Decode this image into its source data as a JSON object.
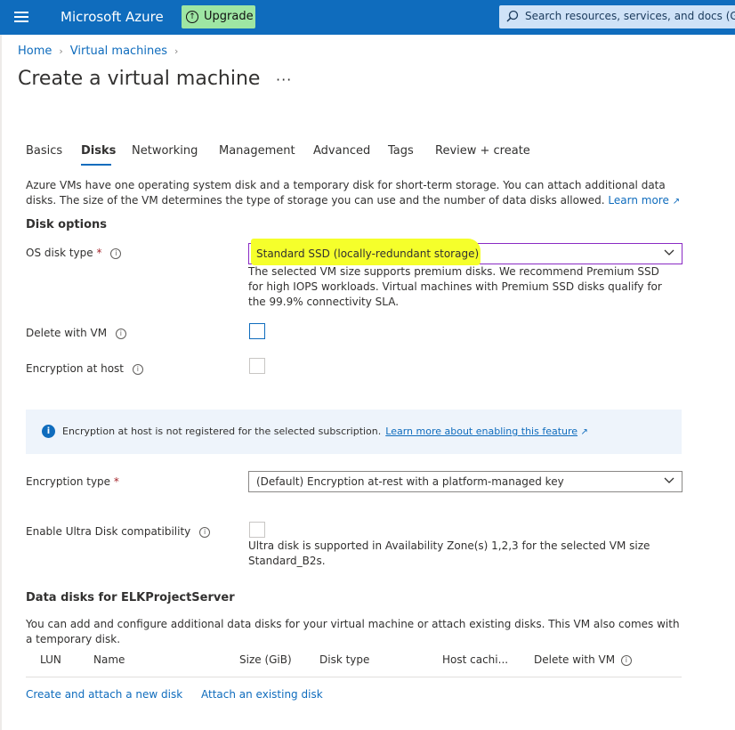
{
  "topbar": {
    "brand": "Microsoft Azure",
    "upgrade_label": "Upgrade",
    "search_placeholder": "Search resources, services, and docs (G+/)"
  },
  "breadcrumb": [
    "Home",
    "Virtual machines"
  ],
  "page_title": "Create a virtual machine",
  "tabs": [
    "Basics",
    "Disks",
    "Networking",
    "Management",
    "Advanced",
    "Tags",
    "Review + create"
  ],
  "active_tab": "Disks",
  "intro": {
    "text": "Azure VMs have one operating system disk and a temporary disk for short-term storage. You can attach additional data disks. The size of the VM determines the type of storage you can use and the number of data disks allowed.",
    "learn_more": "Learn more"
  },
  "disk_options": {
    "heading": "Disk options",
    "os_disk_type": {
      "label": "OS disk type",
      "required": "*",
      "value": "Standard SSD (locally-redundant storage)",
      "helper": "The selected VM size supports premium disks. We recommend Premium SSD for high IOPS workloads. Virtual machines with Premium SSD disks qualify for the 99.9% connectivity SLA.",
      "highlight_color": "#f5ff2b"
    },
    "delete_with_vm": {
      "label": "Delete with VM",
      "checked": false
    },
    "encryption_at_host": {
      "label": "Encryption at host",
      "checked": false,
      "disabled": true
    },
    "banner": {
      "text": "Encryption at host is not registered for the selected subscription.",
      "link": "Learn more about enabling this feature"
    },
    "encryption_type": {
      "label": "Encryption type",
      "required": "*",
      "value": "(Default) Encryption at-rest with a platform-managed key"
    },
    "ultra_disk": {
      "label": "Enable Ultra Disk compatibility",
      "checked": false,
      "helper_line1": "Ultra disk is supported in Availability Zone(s) 1,2,3 for the selected VM size",
      "helper_line2": "Standard_B2s."
    }
  },
  "data_disks": {
    "heading": "Data disks for ELKProjectServer",
    "description": "You can add and configure additional data disks for your virtual machine or attach existing disks. This VM also comes with a temporary disk.",
    "columns": [
      "LUN",
      "Name",
      "Size (GiB)",
      "Disk type",
      "Host cachi...",
      "Delete with VM"
    ],
    "create_link": "Create and attach a new disk",
    "attach_link": "Attach an existing disk"
  },
  "colors": {
    "accent": "#0f6cbd",
    "topbar": "#0f6cbd",
    "upgrade": "#9ee6a3",
    "required": "#a4262c"
  }
}
